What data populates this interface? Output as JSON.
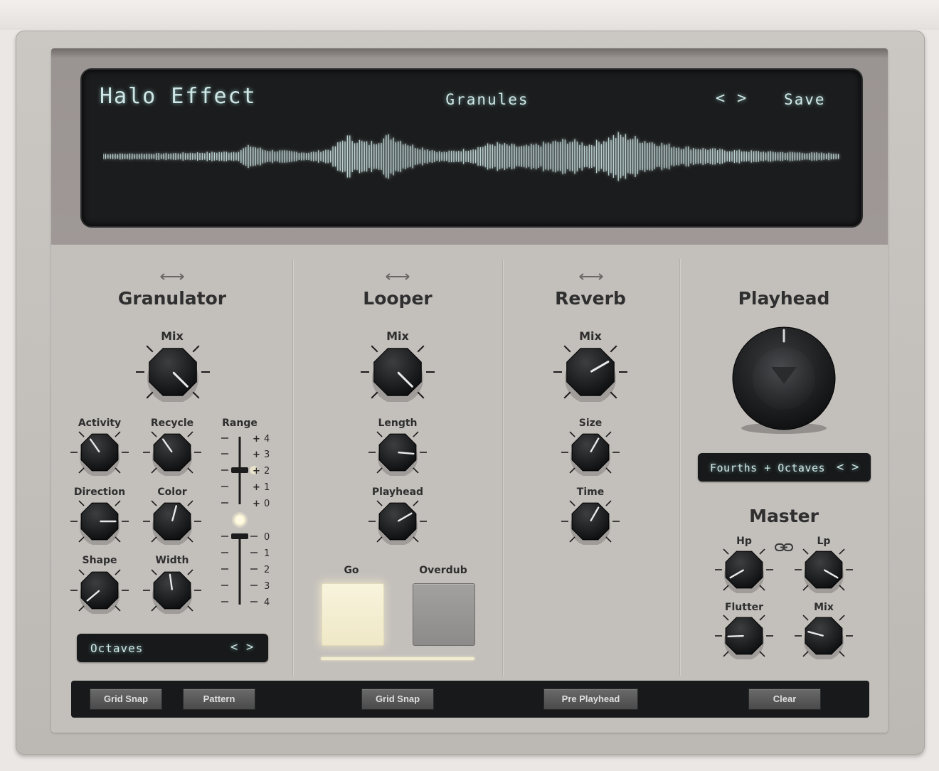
{
  "display": {
    "plugin_name": "Halo Effect",
    "preset_name": "Granules",
    "prev_label": "<",
    "next_label": ">",
    "save_label": "Save",
    "glow_color": "#cfe7e6"
  },
  "granulator": {
    "title": "Granulator",
    "mix_label": "Mix",
    "activity_label": "Activity",
    "recycle_label": "Recycle",
    "direction_label": "Direction",
    "color_label": "Color",
    "shape_label": "Shape",
    "width_label": "Width",
    "range_label": "Range",
    "range_top_ticks": [
      "4",
      "3",
      "2",
      "1",
      "0"
    ],
    "range_bottom_ticks": [
      "0",
      "1",
      "2",
      "3",
      "4"
    ],
    "scale_display": "Octaves"
  },
  "looper": {
    "title": "Looper",
    "mix_label": "Mix",
    "length_label": "Length",
    "playhead_label": "Playhead",
    "go_label": "Go",
    "overdub_label": "Overdub"
  },
  "reverb": {
    "title": "Reverb",
    "mix_label": "Mix",
    "size_label": "Size",
    "time_label": "Time"
  },
  "playhead": {
    "title": "Playhead",
    "scale_display": "Fourths + Octaves"
  },
  "master": {
    "title": "Master",
    "hp_label": "Hp",
    "lp_label": "Lp",
    "flutter_label": "Flutter",
    "mix_label": "Mix"
  },
  "bottom_bar": {
    "grid_snap_1": "Grid Snap",
    "pattern": "Pattern",
    "grid_snap_2": "Grid Snap",
    "pre_playhead": "Pre Playhead",
    "clear": "Clear"
  }
}
